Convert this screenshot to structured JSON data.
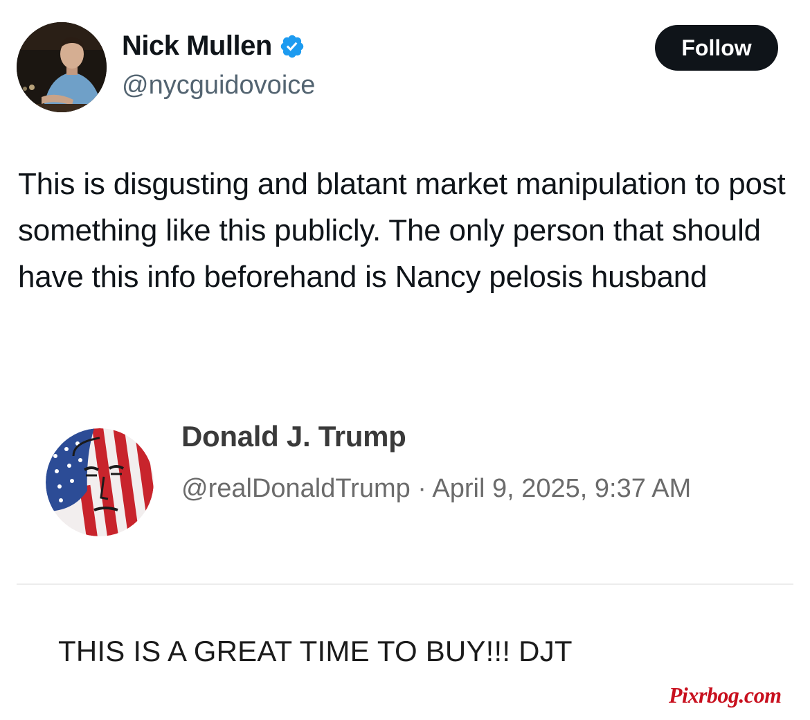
{
  "tweet": {
    "author": {
      "display_name": "Nick Mullen",
      "handle": "@nycguidovoice",
      "verified_icon": "verified-badge-icon",
      "avatar": "profile-photo"
    },
    "follow_label": "Follow",
    "text": "This is disgusting and blatant market manipulation to post something like this publicly. The only person that should have this info beforehand is Nancy pelosis husband"
  },
  "quoted": {
    "display_name": "Donald J. Trump",
    "meta": "@realDonaldTrump · April 9, 2025, 9:37 AM",
    "avatar": "flag-portrait",
    "body": "THIS IS A GREAT TIME TO BUY!!! DJT"
  },
  "watermark": "Pixrbog.com",
  "colors": {
    "follow_bg": "#0f1419",
    "verified": "#1d9bf0",
    "handle": "#536471",
    "watermark": "#c8101e"
  }
}
